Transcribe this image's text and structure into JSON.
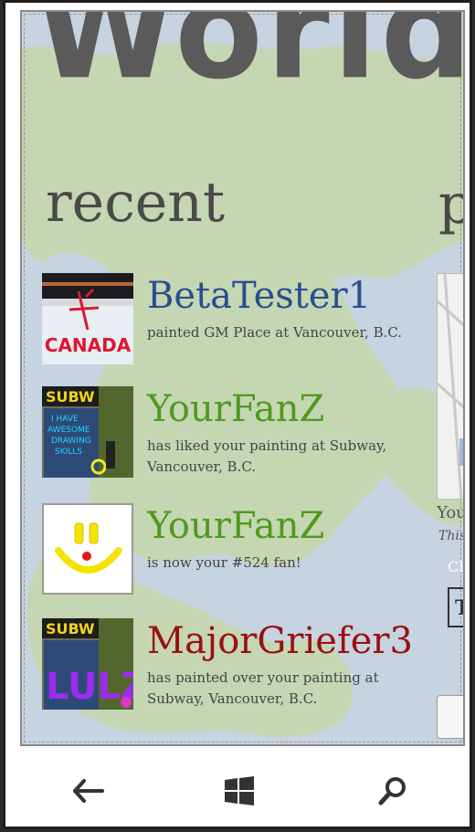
{
  "app": {
    "title": "World P",
    "section_recent": "recent",
    "section_next_partial": "p"
  },
  "feed": [
    {
      "username": "BetaTester1",
      "description": "painted GM Place at Vancouver, B.C.",
      "color": "#2a4f8f",
      "thumb": "hockey-rink-canada"
    },
    {
      "username": "YourFanZ",
      "description": "has liked your painting at Subway, Vancouver, B.C.",
      "color": "#4f9a1c",
      "thumb": "subway-awesome-drawing"
    },
    {
      "username": "YourFanZ",
      "description": "is now your #524 fan!",
      "color": "#4f9a1c",
      "thumb": "smiley-face"
    },
    {
      "username": "MajorGriefer3",
      "description": "has painted over your painting at Subway, Vancouver, B.C.",
      "color": "#9a1010",
      "thumb": "subway-lulz"
    }
  ],
  "side_panel": {
    "you_label": "You",
    "this_label": "This",
    "ch_label": "Ch",
    "button_label": "T"
  },
  "navbar": {
    "back": "back-icon",
    "home": "windows-icon",
    "search": "search-icon"
  }
}
